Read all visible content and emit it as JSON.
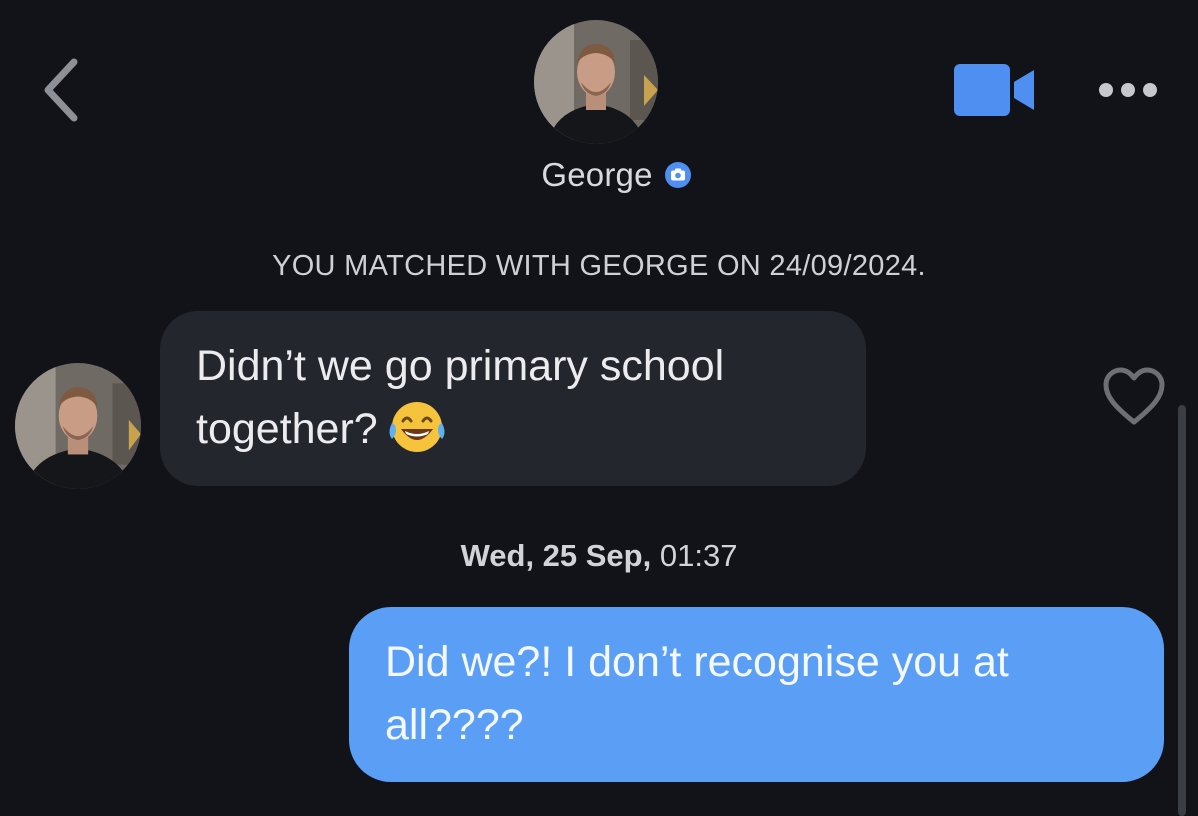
{
  "header": {
    "contact_name": "George",
    "back_icon": "chevron-left-icon",
    "video_icon": "video-camera-icon",
    "more_icon": "ellipsis-icon",
    "verified_icon": "verified-camera-badge-icon",
    "accent_color": "#4f8ff2"
  },
  "conversation": {
    "match_notice": "YOU MATCHED WITH GEORGE ON 24/09/2024.",
    "messages": [
      {
        "direction": "incoming",
        "text": "Didn’t we go primary school together?",
        "emoji": "face-with-tears-of-joy",
        "like_icon": "heart-outline-icon"
      },
      {
        "direction": "outgoing",
        "text": "Did we?! I don’t recognise you at all????"
      }
    ],
    "timestamp_day": "Wed, 25 Sep,",
    "timestamp_time": "01:37"
  },
  "colors": {
    "background": "#121318",
    "incoming_bubble": "#24262d",
    "outgoing_bubble": "#5b9ef5"
  }
}
